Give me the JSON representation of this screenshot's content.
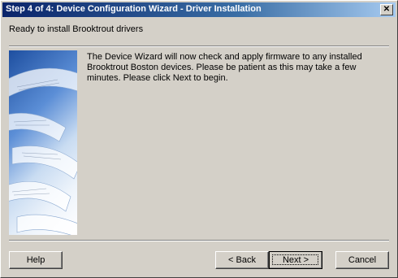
{
  "window": {
    "title": "Step 4 of 4: Device Configuration Wizard - Driver Installation",
    "close_glyph": "✕"
  },
  "header": {
    "text": "Ready to install Brooktrout drivers"
  },
  "main": {
    "body_text": "The Device Wizard will now check and apply firmware to any installed Brooktrout Boston devices. Please be patient as this may take a few minutes. Please click Next to begin."
  },
  "buttons": {
    "help": "Help",
    "back": "< Back",
    "next": "Next >",
    "cancel": "Cancel"
  },
  "colors": {
    "face": "#d4d0c8",
    "title_start": "#0a246a",
    "title_end": "#a6caf0"
  }
}
